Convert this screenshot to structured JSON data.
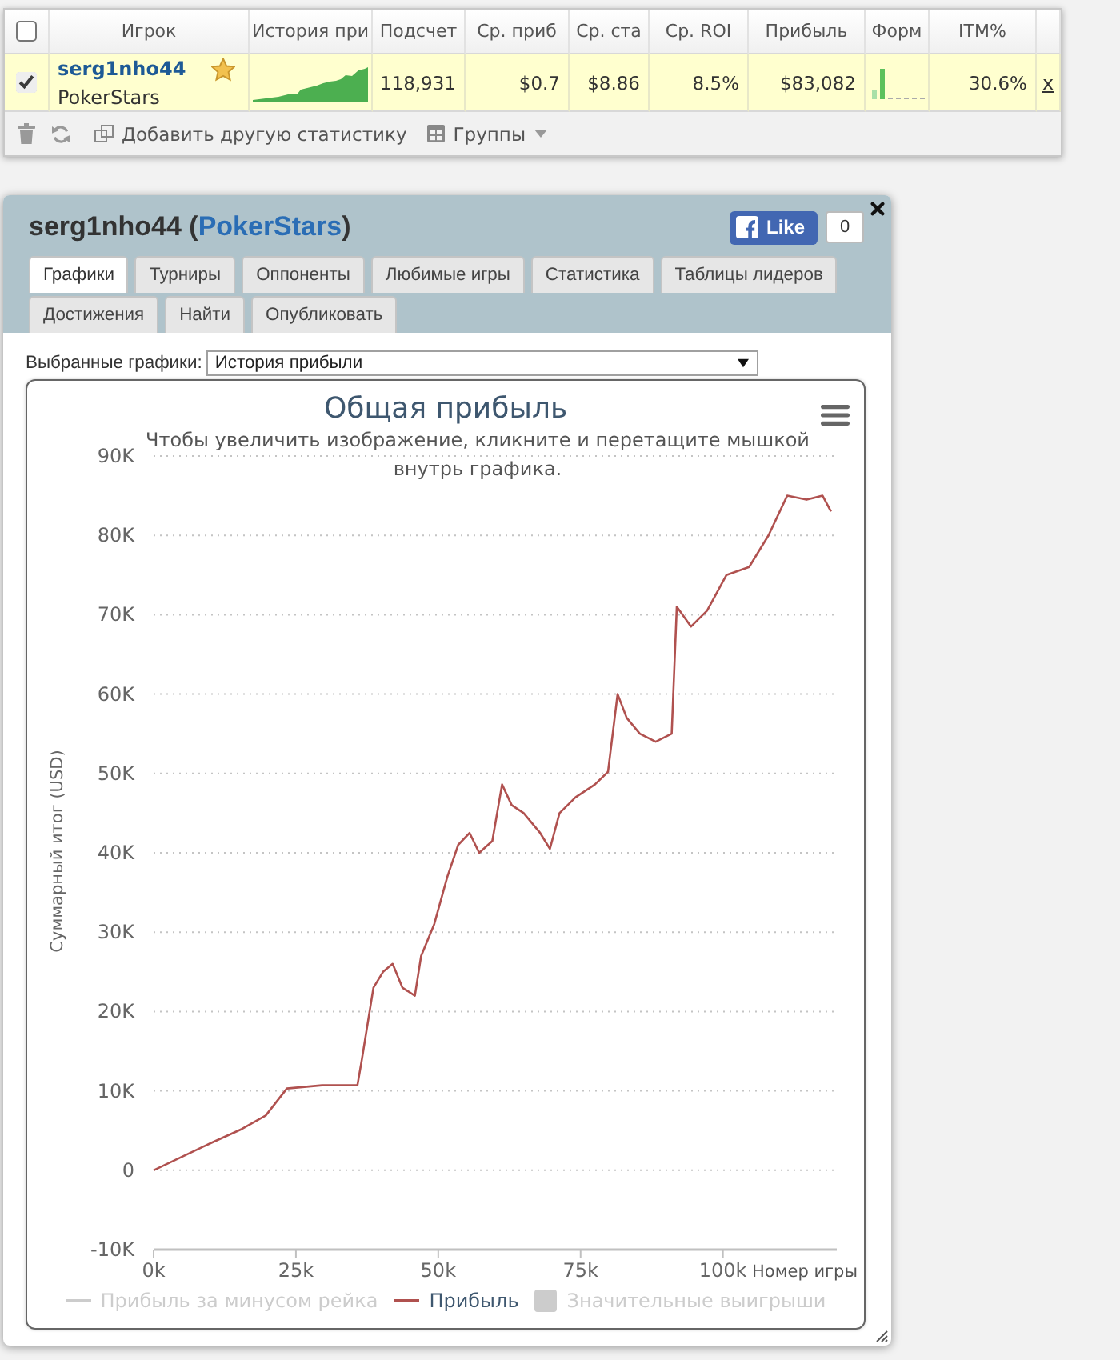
{
  "stats_table": {
    "header_checkbox": {
      "checked": false
    },
    "columns": [
      "Игрок",
      "История при",
      "Подсчет",
      "Ср. приб",
      "Ср. ста",
      "Ср. ROI",
      "Прибыль",
      "Форм",
      "ITM%"
    ],
    "rows": [
      {
        "selected": true,
        "player": "serg1nho44",
        "site": "PokerStars",
        "favorite": true,
        "count": "118,931",
        "avg_profit": "$0.7",
        "avg_stake": "$8.86",
        "avg_roi": "8.5%",
        "profit": "$83,082",
        "itm": "30.6%",
        "remove": "x"
      }
    ],
    "toolbar": {
      "add_statistic": "Добавить другую статистику",
      "groups": "Группы"
    }
  },
  "player_panel": {
    "title": [
      {
        "kind": "text",
        "text": "serg1nho44 ("
      },
      {
        "kind": "link",
        "text": "PokerStars"
      },
      {
        "kind": "text",
        "text": ")"
      }
    ],
    "like_button": {
      "label": "Like",
      "count": "0"
    },
    "tabs": [
      {
        "label": "Графики",
        "selected": true
      },
      {
        "label": "Турниры",
        "selected": false
      },
      {
        "label": "Оппоненты",
        "selected": false
      },
      {
        "label": "Любимые игры",
        "selected": false
      },
      {
        "label": "Статистика",
        "selected": false
      },
      {
        "label": "Таблицы лидеров",
        "selected": false
      },
      {
        "label": "Достижения",
        "selected": false
      },
      {
        "label": "Найти",
        "selected": false
      },
      {
        "label": "Опубликовать",
        "selected": false
      }
    ],
    "chart_picker": {
      "label": "Выбранные графики:",
      "value": "История прибыли"
    },
    "chart": {
      "subtitle": "Чтобы увеличить изображение, кликните и перетащите мышкой внутрь графика.",
      "legend": [
        {
          "kind": "line",
          "enabled": false,
          "label": "Прибыль за минусом рейка"
        },
        {
          "kind": "series",
          "enabled": true
        },
        {
          "kind": "square",
          "enabled": false,
          "label": "Значительные выигрыши"
        }
      ],
      "chart_data": {
        "type": "line",
        "title": "Общая прибыль",
        "xlabel": "Номер игры",
        "ylabel": "Суммарный итог (USD)",
        "grid": true,
        "x": [
          0,
          10000,
          15500,
          19700,
          23400,
          29600,
          35800,
          36600,
          38600,
          40300,
          42000,
          43700,
          45900,
          47000,
          49300,
          51600,
          53500,
          55500,
          57200,
          59500,
          61200,
          62900,
          65000,
          67900,
          69600,
          71300,
          74100,
          77500,
          79800,
          81500,
          83100,
          85400,
          88200,
          91000,
          91900,
          94400,
          97200,
          100600,
          104600,
          108000,
          111300,
          114700,
          117500,
          119000
        ],
        "series": [
          {
            "name": "Прибыль",
            "color": "#b0514f",
            "values": [
              0,
              3400,
              5200,
              6900,
              10300,
              10700,
              10700,
              14000,
              23000,
              25000,
              26000,
              23000,
              22000,
              27000,
              31000,
              37000,
              41000,
              42500,
              40000,
              41500,
              48600,
              46000,
              45000,
              42500,
              40500,
              45000,
              47000,
              48600,
              50200,
              60000,
              57000,
              55000,
              54000,
              55000,
              71000,
              68500,
              70500,
              75000,
              76000,
              80000,
              85000,
              84500,
              85000,
              83000
            ]
          }
        ],
        "xlim": [
          0,
          120000
        ],
        "ylim": [
          -10000,
          90000
        ],
        "xticks": [
          {
            "value": 0,
            "label": "0k"
          },
          {
            "value": 25000,
            "label": "25k"
          },
          {
            "value": 50000,
            "label": "50k"
          },
          {
            "value": 75000,
            "label": "75k"
          },
          {
            "value": 100000,
            "label": "100k"
          }
        ],
        "yticks": [
          {
            "value": -10000,
            "label": "-10K"
          },
          0,
          {
            "value": 10000,
            "label": "10K"
          },
          {
            "value": 20000,
            "label": "20K"
          },
          {
            "value": 30000,
            "label": "30K"
          },
          {
            "value": 40000,
            "label": "40K"
          },
          {
            "value": 50000,
            "label": "50K"
          },
          {
            "value": 60000,
            "label": "60K"
          },
          {
            "value": 70000,
            "label": "70K"
          },
          {
            "value": 80000,
            "label": "80K"
          },
          {
            "value": 90000,
            "label": "90K"
          }
        ]
      }
    }
  }
}
